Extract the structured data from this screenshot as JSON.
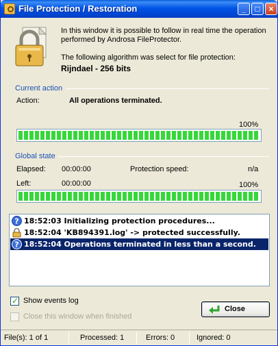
{
  "window": {
    "title": "File Protection / Restoration"
  },
  "intro": {
    "description": "In this window it is possible to follow in real time the operation performed by Androsa FileProtector.",
    "algorithm_intro": "The following algorithm was select for file protection:",
    "algorithm": "Rijndael - 256 bits"
  },
  "current_action": {
    "section_title": "Current action",
    "action_label": "Action:",
    "action_value": "All operations terminated.",
    "percent_text": "100%",
    "progress": 1.0
  },
  "global_state": {
    "section_title": "Global state",
    "elapsed_label": "Elapsed:",
    "elapsed_value": "00:00:00",
    "speed_label": "Protection speed:",
    "speed_value": "n/a",
    "left_label": "Left:",
    "left_value": "00:00:00",
    "percent_text": "100%",
    "progress": 1.0
  },
  "log": [
    {
      "icon": "info-icon",
      "text": "18:52:03 Initializing protection procedures...",
      "selected": false
    },
    {
      "icon": "lock-icon",
      "text": "18:52:04 'KB894391.log' -> protected successfully.",
      "selected": false
    },
    {
      "icon": "info-icon",
      "text": "18:52:04 Operations terminated in less than a second.",
      "selected": true
    }
  ],
  "options": {
    "show_events_log": {
      "label": "Show events log",
      "checked": true,
      "enabled": true
    },
    "close_when_finished": {
      "label": "Close this window when finished",
      "checked": false,
      "enabled": false
    }
  },
  "buttons": {
    "close_label": "Close"
  },
  "status": {
    "files": "File(s): 1 of 1",
    "processed": "Processed: 1",
    "errors": "Errors: 0",
    "ignored": "Ignored: 0"
  },
  "colors": {
    "titlebar": "#0055e5",
    "progress_fill": "#37d73a",
    "selection": "#0a246a",
    "section_title": "#1a50b8",
    "window_bg": "#ece9d8"
  }
}
